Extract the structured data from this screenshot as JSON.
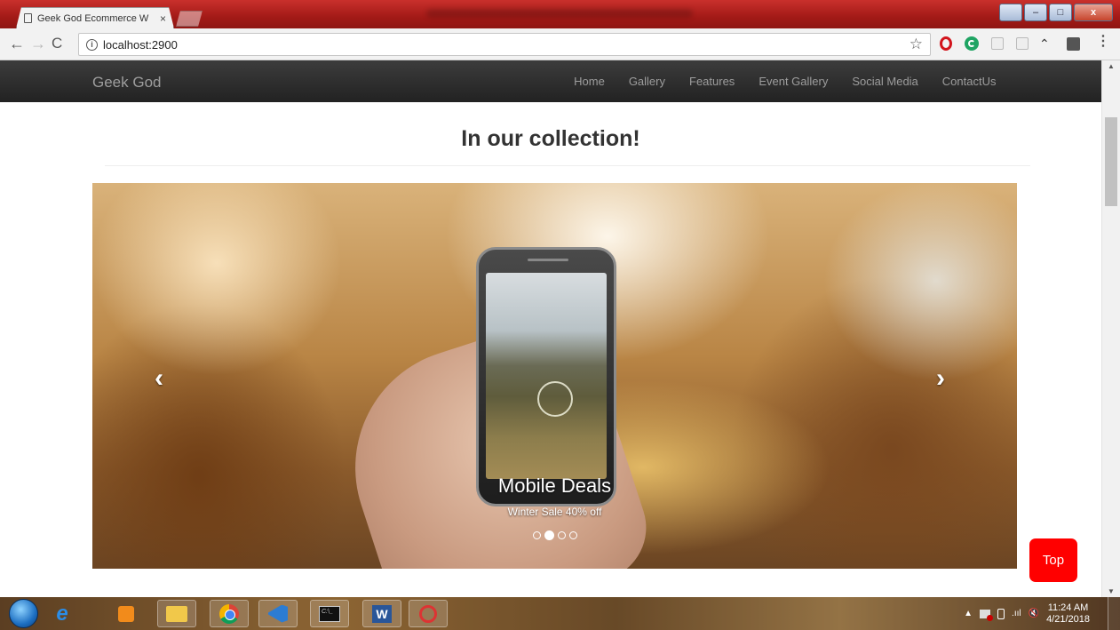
{
  "browser": {
    "tab_title": "Geek God Ecommerce W",
    "tab_close": "×",
    "url": "localhost:2900",
    "info_glyph": "i",
    "back_glyph": "←",
    "forward_glyph": "→",
    "reload_glyph": "C",
    "star_glyph": "☆",
    "menu_glyph": "⋮",
    "extensions": [
      "opera-icon",
      "grammarly-icon",
      "extension-icon",
      "reader-icon",
      "arrow-icon",
      "dark-extension-icon"
    ]
  },
  "window": {
    "minimize_glyph": "–",
    "maximize_glyph": "□",
    "close_glyph": "x"
  },
  "navbar": {
    "brand": "Geek God",
    "links": [
      "Home",
      "Gallery",
      "Features",
      "Event Gallery",
      "Social Media",
      "ContactUs"
    ]
  },
  "main": {
    "heading": "In our collection!",
    "carousel": {
      "caption_title": "Mobile Deals",
      "caption_subtitle": "Winter Sale 40% off",
      "prev_glyph": "‹",
      "next_glyph": "›",
      "slide_count": 4,
      "active_slide": 2
    },
    "top_button": "Top"
  },
  "taskbar": {
    "apps": [
      "windows-start",
      "internet-explorer",
      "media-center",
      "file-explorer",
      "google-chrome",
      "visual-studio-code",
      "command-prompt",
      "microsoft-word",
      "snipping-tool"
    ],
    "word_letter": "W",
    "cmd_text": "C:\\_",
    "tray_up": "▲",
    "signal": ".ııl",
    "time": "11:24 AM",
    "date": "4/21/2018"
  },
  "colors": {
    "titlebar": "#a31a17",
    "navbar": "#222222",
    "nav_text": "#9d9d9d",
    "top_button": "#ff0000"
  }
}
